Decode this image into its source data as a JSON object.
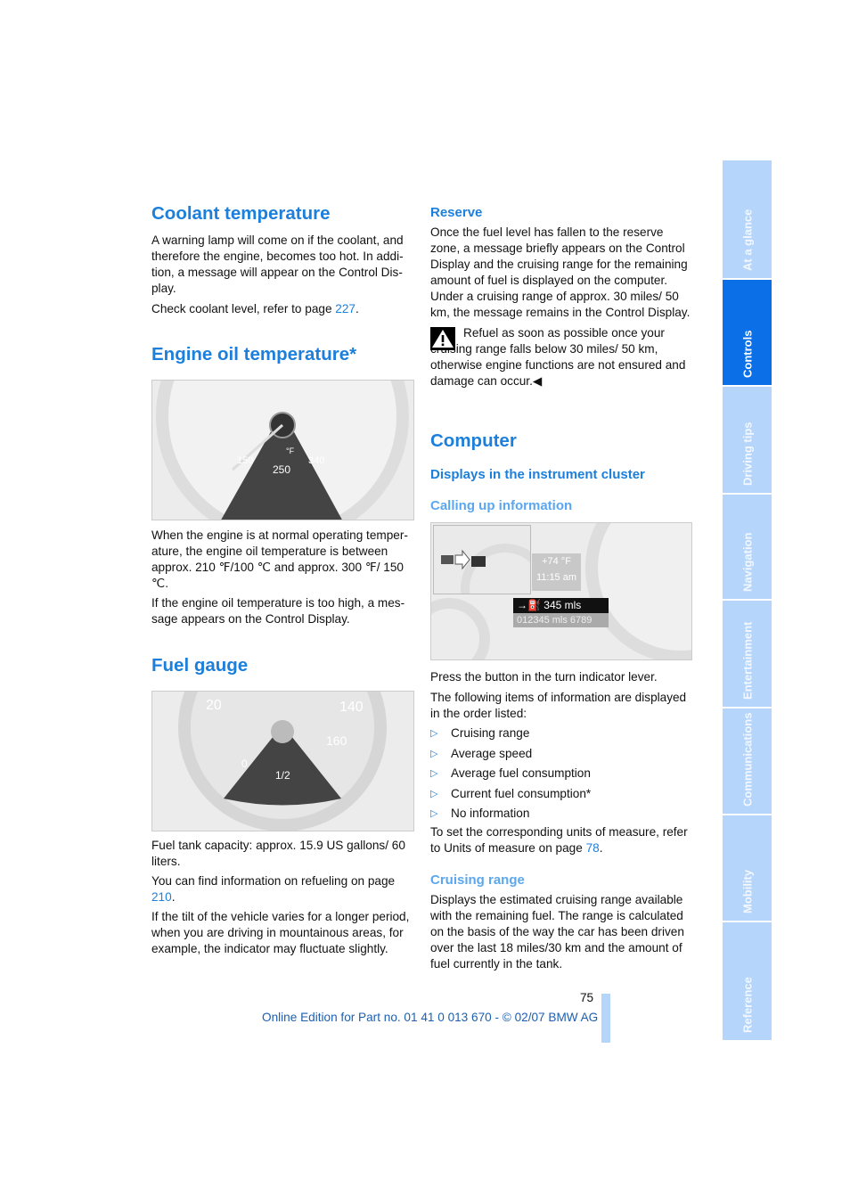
{
  "coolant": {
    "title": "Coolant temperature",
    "p1": "A warning lamp will come on if the coolant, and therefore the engine, becomes too hot. In addi­tion, a message will appear on the Control Dis­play.",
    "p2_pre": "Check coolant level, refer to page ",
    "p2_link": "227",
    "p2_post": "."
  },
  "oil": {
    "title": "Engine oil temperature*",
    "gauge_labels": [
      "150",
      "250",
      "340",
      "°F"
    ],
    "p1": "When the engine is at normal operating temper­ature, the engine oil temperature is between approx. 210 ℉/100 ℃ and approx. 300 ℉/ 150 ℃.",
    "p2": "If the engine oil temperature is too high, a mes­sage appears on the Control Display."
  },
  "fuel": {
    "title": "Fuel gauge",
    "gauge_labels": [
      "0",
      "1/2",
      "20",
      "140",
      "160"
    ],
    "p1": "Fuel tank capacity: approx. 15.9 US gallons/ 60 liters.",
    "p2_pre": "You can find information on refueling on page ",
    "p2_link": "210",
    "p2_post": ".",
    "p3": "If the tilt of the vehicle varies for a longer period, when you are driving in mountainous areas, for example, the indicator may fluctuate slightly."
  },
  "reserve": {
    "title": "Reserve",
    "p1": "Once the fuel level has fallen to the reserve zone, a message briefly appears on the Control Display and the cruising range for the remaining amount of fuel is displayed on the computer. Under a cruising range of approx. 30 miles/ 50 km, the message remains in the Control Dis­play.",
    "warning_icon": "warning-triangle-icon",
    "warning": "Refuel as soon as possible once your cruising range falls below 30 miles/ 50 km, otherwise engine functions are not ensured and damage can occur.◀"
  },
  "computer": {
    "title": "Computer",
    "subtitle": "Displays in the instrument cluster",
    "calling_title": "Calling up information",
    "display": {
      "temp": "+74 °F",
      "time": "11:15 am",
      "range": "345 mls",
      "odometer": "012345 mls 6789"
    },
    "p1": "Press the button in the turn indicator lever.",
    "p2": "The following items of information are dis­played in the order listed:",
    "items": [
      "Cruising range",
      "Average speed",
      "Average fuel consumption",
      "Current fuel consumption*",
      "No information"
    ],
    "p3_pre": "To set the corresponding units of measure, refer to Units of measure on page ",
    "p3_link": "78",
    "p3_post": ".",
    "cruising_title": "Cruising range",
    "cruising_text": "Displays the estimated cruising range available with the remaining fuel. The range is calculated on the basis of the way the car has been driven over the last 18 miles/30 km and the amount of fuel currently in the tank."
  },
  "footer": {
    "page_number": "75",
    "edition": "Online Edition for Part no. 01 41 0 013 670 - © 02/07 BMW AG"
  },
  "tabs": [
    {
      "label": "At a glance"
    },
    {
      "label": "Controls",
      "active": true
    },
    {
      "label": "Driving tips"
    },
    {
      "label": "Navigation"
    },
    {
      "label": "Entertainment"
    },
    {
      "label": "Communications"
    },
    {
      "label": "Mobility"
    },
    {
      "label": "Reference"
    }
  ],
  "colors": {
    "heading": "#1d7fdc",
    "subheading": "#5ba7ef",
    "tab": "#b5d5fb",
    "tab_active": "#0b6fe8"
  }
}
